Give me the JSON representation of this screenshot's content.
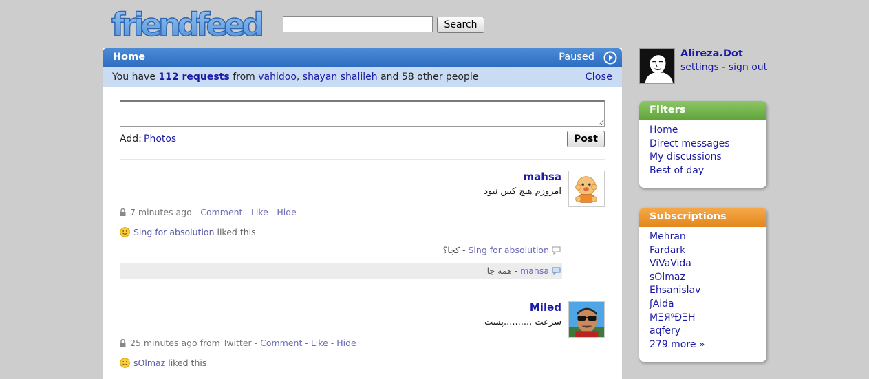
{
  "header": {
    "logo_text": "friendfeed",
    "search_value": "",
    "search_button": "Search"
  },
  "main": {
    "title": "Home",
    "status": "Paused",
    "requests": {
      "prefix": "You have",
      "count_text": "112 requests",
      "from": "from",
      "user1": "vahidoo",
      "sep": ",",
      "user2": "shayan shalileh",
      "suffix": "and 58 other people",
      "close": "Close"
    },
    "composer": {
      "value": "",
      "add_label": "Add:",
      "photos": "Photos",
      "post_button": "Post"
    },
    "entries": [
      {
        "name": "mahsa",
        "text": "امروزم هیچ کس نبود",
        "time": "7 minutes ago",
        "source": "",
        "comment": "Comment",
        "like": "Like",
        "hide": "Hide",
        "liker": "Sing for absolution",
        "liked_text": "liked this",
        "comments": [
          {
            "text": "کجا؟",
            "author": "Sing for absolution"
          },
          {
            "text": "همه جا",
            "author": "mahsa"
          }
        ]
      },
      {
        "name": "Miləd",
        "text": "سرعت ..........پست",
        "time": "25 minutes ago",
        "source": "from Twitter",
        "comment": "Comment",
        "like": "Like",
        "hide": "Hide",
        "liker": "sOlmaz",
        "liked_text": "liked this"
      }
    ]
  },
  "profile": {
    "name": "Alireza.Dot",
    "settings": "settings",
    "dash": "-",
    "sign_out": "sign out"
  },
  "filters": {
    "title": "Filters",
    "items": [
      "Home",
      "Direct messages",
      "My discussions",
      "Best of day"
    ]
  },
  "subscriptions": {
    "title": "Subscriptions",
    "items": [
      "Mehran",
      "Fardark",
      "ViVaVida",
      "sOlmaz",
      "Ehsanislav",
      "ʃAida",
      "MΞЯ⁹ÐΞΗ",
      "aqfery",
      "279 more »"
    ]
  },
  "colors": {
    "header_blue": "#2d6cc0",
    "request_bar": "#c9dcf4",
    "link": "#1a1aa6",
    "filters_green": "#5fa33a",
    "subscriptions_orange": "#e2871c",
    "background": "#cdcdcd"
  }
}
